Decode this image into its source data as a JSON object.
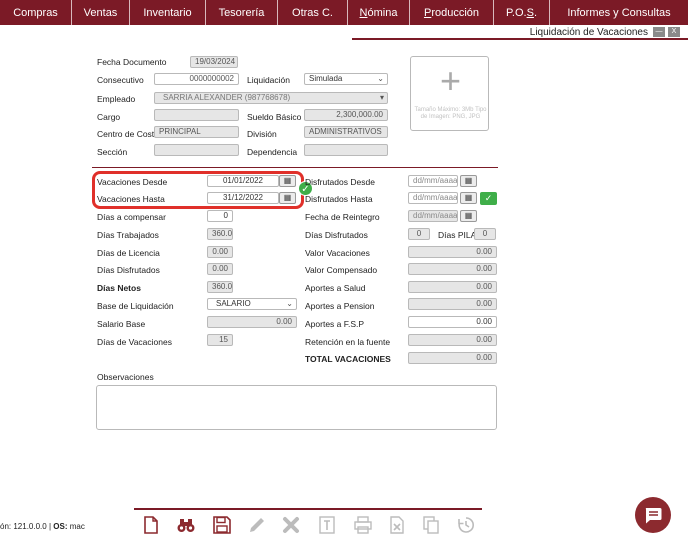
{
  "menu": {
    "items": [
      {
        "label": "Compras"
      },
      {
        "label": "Ventas"
      },
      {
        "label": "Inventario"
      },
      {
        "label": "Tesorería"
      },
      {
        "label": "Otras C."
      },
      {
        "label": "Nómina",
        "underline": "N",
        "rest": "ómina"
      },
      {
        "label": "Producción",
        "underline": "P",
        "rest": "roducción"
      },
      {
        "label": "P.O.S.",
        "pre": "P.O.",
        "underline": "S",
        "post": "."
      },
      {
        "label": "Informes y Consultas"
      }
    ]
  },
  "window": {
    "title": "Liquidación de Vacaciones",
    "minimize_label": "—",
    "close_label": "X"
  },
  "form": {
    "fecha_documento_label": "Fecha Documento",
    "fecha_documento_value": "19/03/2024",
    "consecutivo_label": "Consecutivo",
    "consecutivo_value": "0000000002",
    "liquidacion_label": "Liquidación",
    "liquidacion_value": "Simulada",
    "empleado_label": "Empleado",
    "empleado_value": "SARRIA ALEXANDER (987768678)",
    "cargo_label": "Cargo",
    "cargo_value": "",
    "sueldo_basico_label": "Sueldo Básico",
    "sueldo_basico_value": "2,300,000.00",
    "centro_costo_label": "Centro de Costo",
    "centro_costo_value": "PRINCIPAL",
    "division_label": "División",
    "division_value": "ADMINISTRATIVOS",
    "seccion_label": "Sección",
    "seccion_value": "",
    "dependencia_label": "Dependencia",
    "dependencia_value": "",
    "image_hint": "Tamaño Máximo: 3Mb Tipo de Imagen: PNG, JPG"
  },
  "vacaciones": {
    "desde_label": "Vacaciones Desde",
    "desde_value": "01/01/2022",
    "hasta_label": "Vacaciones Hasta",
    "hasta_value": "31/12/2022",
    "dias_compensar_label": "Días a compensar",
    "dias_compensar_value": "0",
    "dias_trabajados_label": "Días Trabajados",
    "dias_trabajados_value": "360.0",
    "dias_licencia_label": "Días de Licencia",
    "dias_licencia_value": "0.00",
    "dias_disfrutados_label": "Días Disfrutados",
    "dias_disfrutados_value": "0.00",
    "dias_netos_label": "Días Netos",
    "dias_netos_value": "360.0",
    "base_liquidacion_label": "Base de Liquidación",
    "base_liquidacion_value": "SALARIO",
    "salario_base_label": "Salario Base",
    "salario_base_value": "0.00",
    "dias_vacaciones_label": "Días de Vacaciones",
    "dias_vacaciones_value": "15"
  },
  "disfrute": {
    "desde_label": "Disfrutados Desde",
    "desde_placeholder": "dd/mm/aaaa",
    "hasta_label": "Disfrutados Hasta",
    "hasta_placeholder": "dd/mm/aaaa",
    "reintegro_label": "Fecha de Reintegro",
    "reintegro_placeholder": "dd/mm/aaaa",
    "dias_disfrutados_label": "Días Disfrutados",
    "dias_disfrutados_value": "0",
    "dias_pila_label": "Días PILA",
    "dias_pila_value": "0",
    "valor_vacaciones_label": "Valor Vacaciones",
    "valor_vacaciones_value": "0.00",
    "valor_compensado_label": "Valor Compensado",
    "valor_compensado_value": "0.00",
    "aportes_salud_label": "Aportes a Salud",
    "aportes_salud_value": "0.00",
    "aportes_pension_label": "Aportes a Pension",
    "aportes_pension_value": "0.00",
    "aportes_fsp_label": "Aportes a F.S.P",
    "aportes_fsp_value": "0.00",
    "retencion_label": "Retención en la fuente",
    "retencion_value": "0.00",
    "total_label": "TOTAL VACACIONES",
    "total_value": "0.00"
  },
  "observaciones_label": "Observaciones",
  "footer": {
    "version_prefix": "ón:",
    "version_value": "121.0.0.0",
    "os_label": "OS:",
    "os_value": "mac"
  },
  "toolbar_icons": [
    "new-document-icon",
    "binoculars-icon",
    "save-icon",
    "edit-pencil-icon",
    "delete-x-icon",
    "text-template-icon",
    "print-icon",
    "excel-export-icon",
    "copy-icon",
    "history-icon"
  ],
  "colors": {
    "brand": "#7b1a26",
    "success": "#3fae49",
    "highlight": "#e0302a",
    "chat": "#8c2a2f"
  }
}
